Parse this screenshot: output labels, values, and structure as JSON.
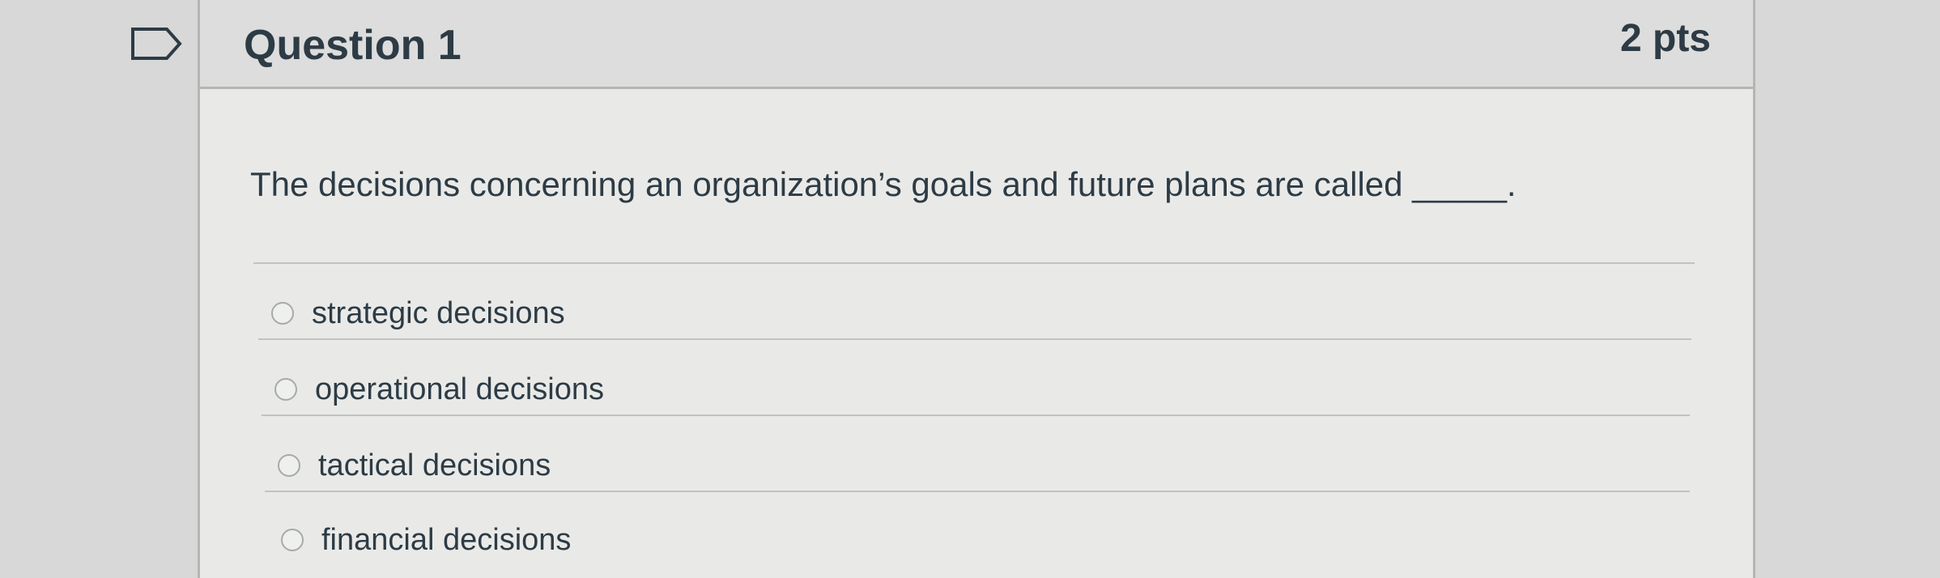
{
  "question": {
    "title": "Question 1",
    "points": "2 pts",
    "text": "The decisions concerning an organization’s goals and future plans are called _____."
  },
  "answers": [
    {
      "label": "strategic decisions"
    },
    {
      "label": "operational decisions"
    },
    {
      "label": "tactical decisions"
    },
    {
      "label": "financial decisions"
    }
  ],
  "icons": {
    "flag": "flag-question-icon"
  },
  "colors": {
    "text": "#2d3b45",
    "page_background": "#d7d8d7",
    "card_background": "#e9eae8",
    "header_background": "#dcdddc",
    "border": "#b4b6b4"
  }
}
